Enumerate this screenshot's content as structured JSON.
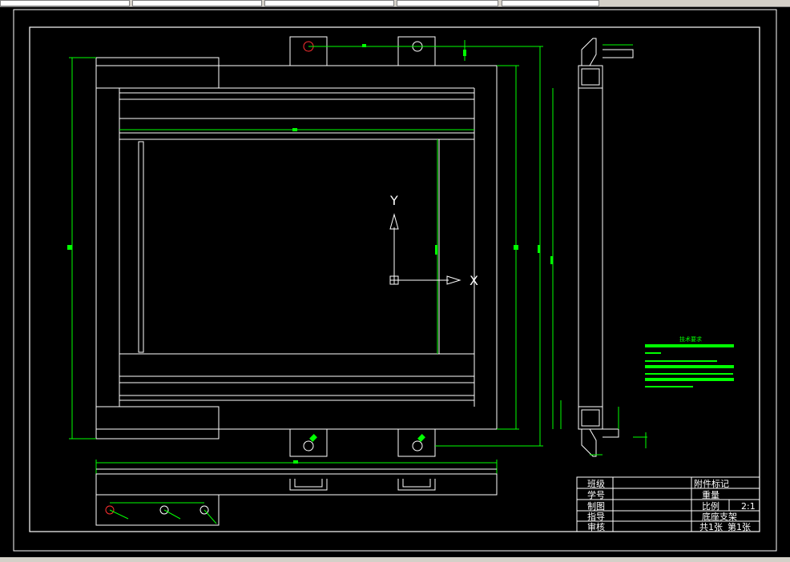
{
  "drawing": {
    "ucs_y_label": "Y",
    "ucs_x_label": "X",
    "tech_requirements_title": "技术要求"
  },
  "title_block": {
    "rows": [
      {
        "left": "班级",
        "right": "附件标记"
      },
      {
        "left": "学号",
        "right": "重量"
      },
      {
        "left": "制图",
        "right": "比例"
      },
      {
        "left": "指导",
        "right": "底座支架"
      },
      {
        "left": "审核",
        "right": "共1张"
      }
    ],
    "scale": "2:1",
    "sheet": "第1张"
  },
  "colors": {
    "line": "#ffffff",
    "dimension": "#00ff00",
    "hole": "#ff3030",
    "background": "#000000"
  }
}
